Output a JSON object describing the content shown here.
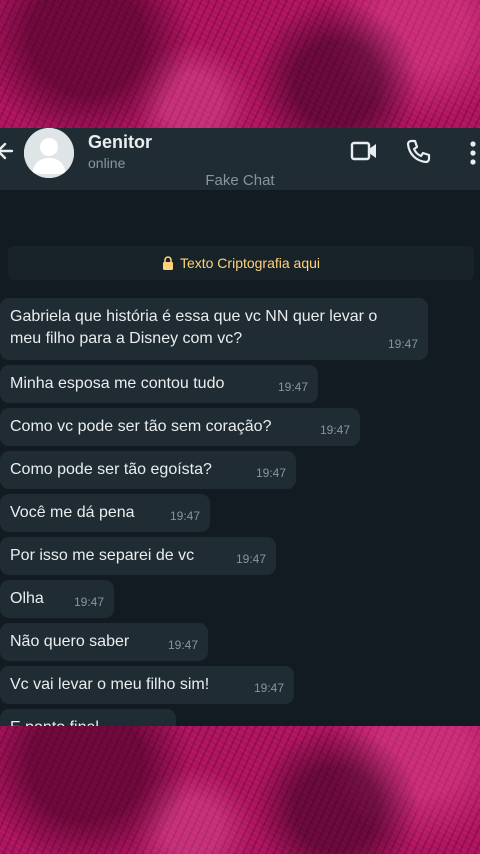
{
  "header": {
    "contact_name": "Genitor",
    "status": "online",
    "subtitle": "Fake Chat"
  },
  "encryption_notice": "Texto Criptografia aqui",
  "messages": [
    {
      "text": "Gabriela que história é essa que vc NN quer levar o meu filho para a Disney com vc?",
      "time": "19:47"
    },
    {
      "text": "Minha esposa me contou tudo",
      "time": "19:47"
    },
    {
      "text": "Como vc pode ser tão sem coração?",
      "time": "19:47"
    },
    {
      "text": "Como pode ser tão egoísta?",
      "time": "19:47"
    },
    {
      "text": "Você me dá pena",
      "time": "19:47"
    },
    {
      "text": "Por isso me separei de vc",
      "time": "19:47"
    },
    {
      "text": "Olha",
      "time": "19:47"
    },
    {
      "text": "Não quero saber",
      "time": "19:47"
    },
    {
      "text": "Vc vai levar o meu filho sim!",
      "time": "19:47"
    },
    {
      "text": "E ponto final",
      "time": ""
    }
  ],
  "icons": [
    "back-arrow-icon",
    "avatar",
    "video-call-icon",
    "phone-icon",
    "more-options-icon",
    "lock-icon"
  ],
  "colors": {
    "chat_background": "#111b21",
    "header_background": "#1f2c34",
    "bubble_background": "#202c33",
    "encryption_text": "#ffd279",
    "frame_magenta": "#b0125f"
  }
}
